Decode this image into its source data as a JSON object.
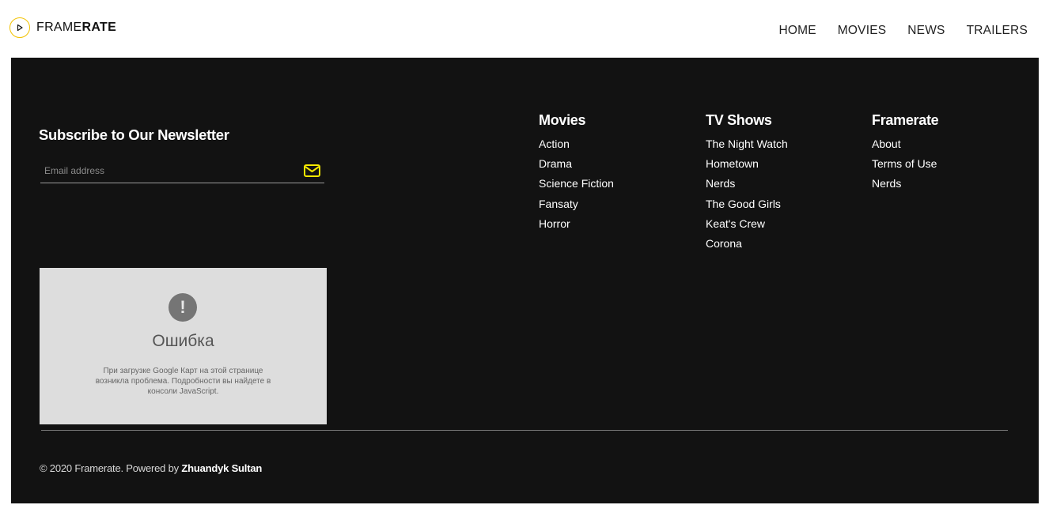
{
  "header": {
    "logo": {
      "text_light": "FRAME",
      "text_bold": "RATE",
      "icon": "play-icon",
      "accent_color": "#f2c200"
    },
    "nav": [
      {
        "label": "HOME"
      },
      {
        "label": "MOVIES"
      },
      {
        "label": "NEWS"
      },
      {
        "label": "TRAILERS"
      }
    ]
  },
  "newsletter": {
    "title": "Subscribe to Our Newsletter",
    "email_placeholder": "Email address",
    "email_value": "",
    "send_icon": "envelope-icon",
    "icon_color": "#f5e800"
  },
  "columns": [
    {
      "title": "Movies",
      "links": [
        "Action",
        "Drama",
        "Science Fiction",
        "Fansaty",
        "Horror"
      ]
    },
    {
      "title": "TV Shows",
      "links": [
        "The Night Watch",
        "Hometown",
        "Nerds",
        "The Good Girls",
        "Keat's Crew",
        "Corona"
      ]
    },
    {
      "title": "Framerate",
      "links": [
        "About",
        "Terms of Use",
        "Nerds"
      ]
    }
  ],
  "map_error": {
    "icon": "exclamation-icon",
    "icon_glyph": "!",
    "title": "Ошибка",
    "message": "При загрузке Google Карт на этой странице возникла проблема. Подробности вы найдете в консоли JavaScript."
  },
  "footer": {
    "copyright_prefix": "© 2020 Framerate. Powered by ",
    "copyright_author": "Zhuandyk Sultan",
    "background_color": "#121212"
  }
}
